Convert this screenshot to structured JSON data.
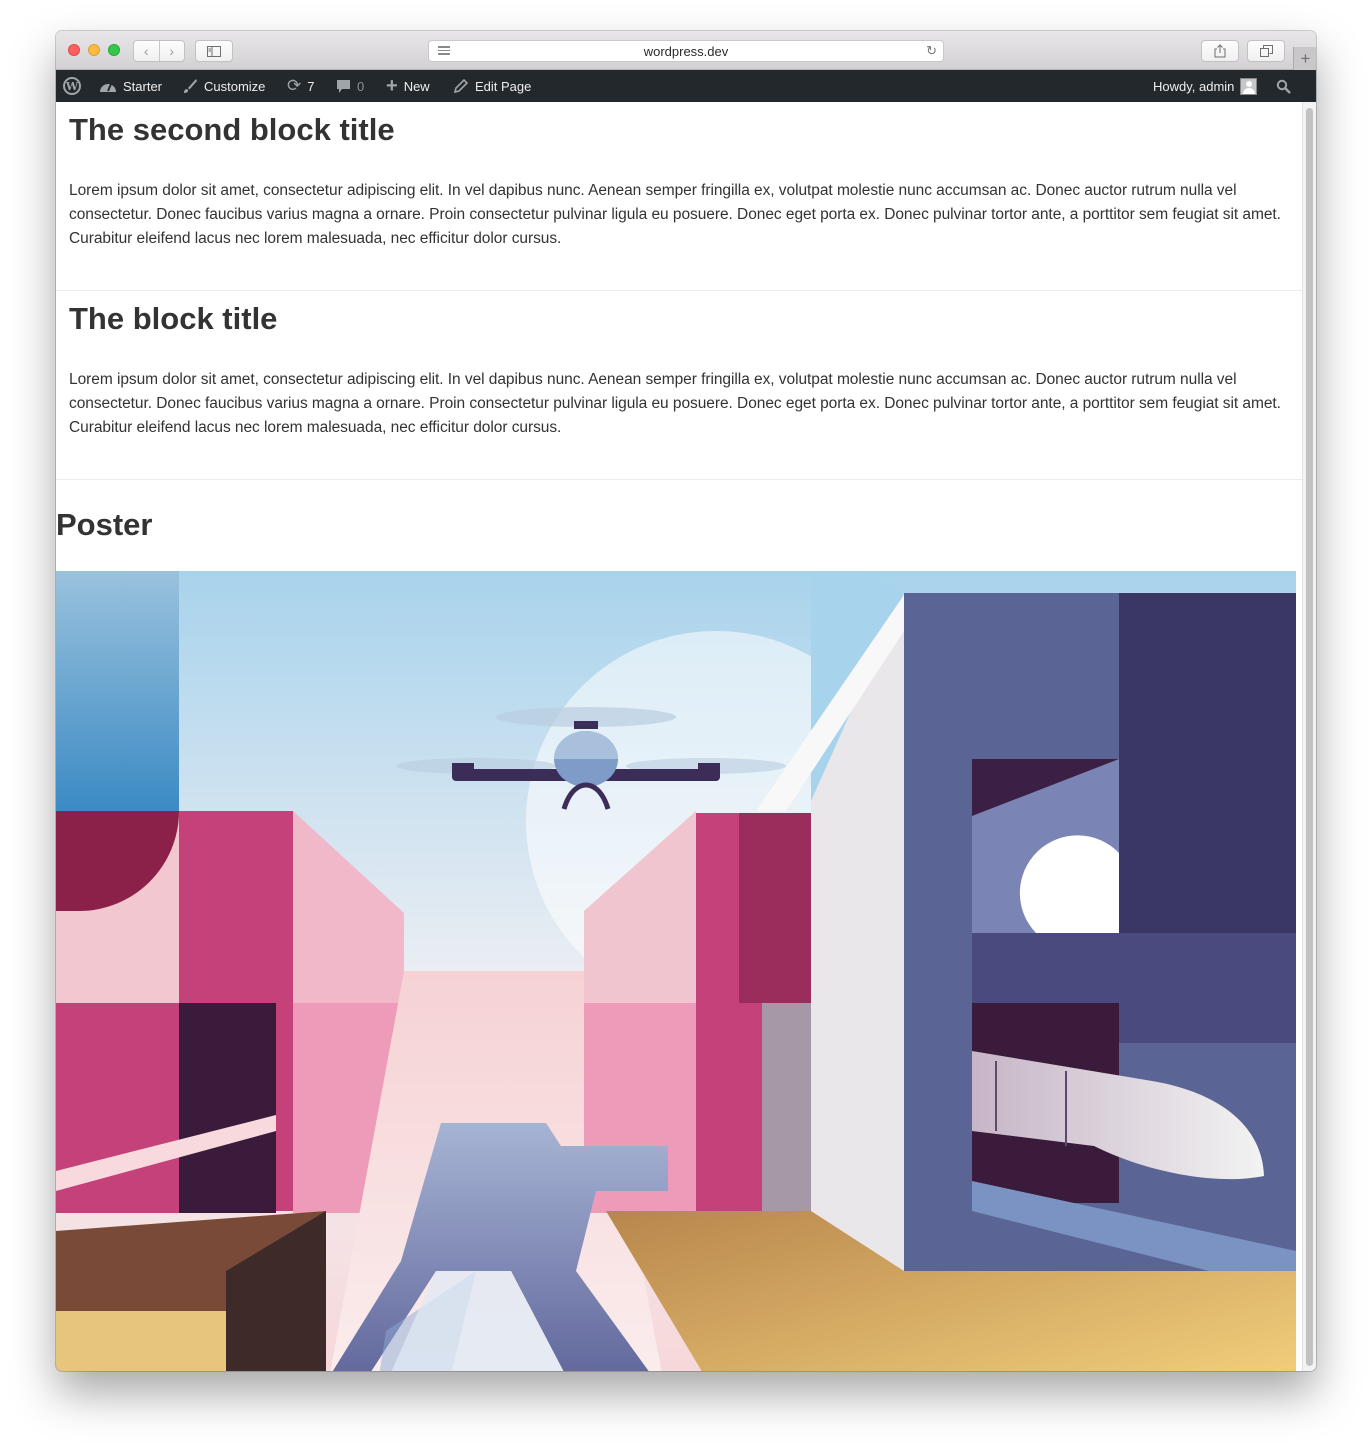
{
  "browser": {
    "url": "wordpress.dev"
  },
  "adminbar": {
    "site_name": "Starter",
    "customize": "Customize",
    "updates_count": "7",
    "comments_count": "0",
    "new": "New",
    "edit_page": "Edit Page",
    "howdy": "Howdy, admin"
  },
  "blocks": [
    {
      "title": "The second block title",
      "text": "Lorem ipsum dolor sit amet, consectetur adipiscing elit. In vel dapibus nunc. Aenean semper fringilla ex, volutpat molestie nunc accumsan ac. Donec auctor rutrum nulla vel consectetur. Donec faucibus varius magna a ornare. Proin consectetur pulvinar ligula eu posuere. Donec eget porta ex. Donec pulvinar tortor ante, a porttitor sem feugiat sit amet. Curabitur eleifend lacus nec lorem malesuada, nec efficitur dolor cursus."
    },
    {
      "title": "The block title",
      "text": "Lorem ipsum dolor sit amet, consectetur adipiscing elit. In vel dapibus nunc. Aenean semper fringilla ex, volutpat molestie nunc accumsan ac. Donec auctor rutrum nulla vel consectetur. Donec faucibus varius magna a ornare. Proin consectetur pulvinar ligula eu posuere. Donec eget porta ex. Donec pulvinar tortor ante, a porttitor sem feugiat sit amet. Curabitur eleifend lacus nec lorem malesuada, nec efficitur dolor cursus."
    }
  ],
  "poster": {
    "title": "Poster"
  },
  "colors": {
    "adminbar_bg": "#23282d",
    "text": "#333333"
  }
}
